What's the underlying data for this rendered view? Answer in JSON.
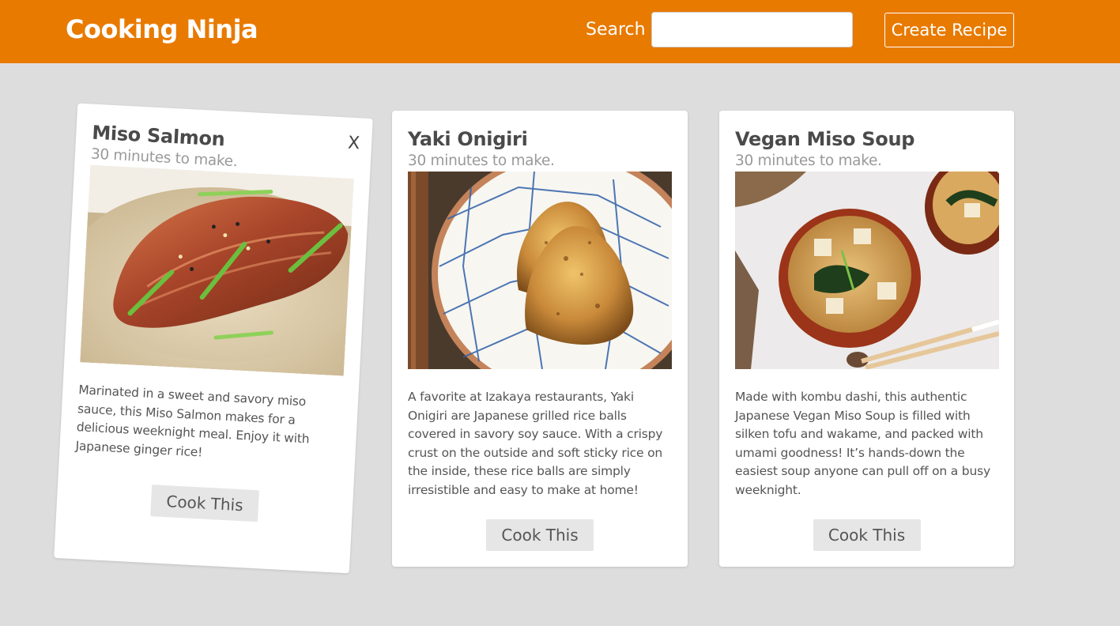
{
  "header": {
    "brand": "Cooking Ninja",
    "search_label": "Search",
    "search_value": "",
    "create_label": "Create Recipe",
    "accent_color": "#e87a00"
  },
  "recipes": [
    {
      "title": "Miso Salmon",
      "time": "30 minutes to make.",
      "image": "miso-salmon-photo",
      "description": "Marinated in a sweet and savory miso sauce, this Miso Salmon makes for a delicious weeknight meal. Enjoy it with Japanese ginger rice!",
      "button": "Cook This",
      "close": "X"
    },
    {
      "title": "Yaki Onigiri",
      "time": "30 minutes to make.",
      "image": "yaki-onigiri-photo",
      "description": "A favorite at Izakaya restaurants, Yaki Onigiri are Japanese grilled rice balls covered in savory soy sauce. With a crispy crust on the outside and soft sticky rice on the inside, these rice balls are simply irresistible and easy to make at home!",
      "button": "Cook This"
    },
    {
      "title": "Vegan Miso Soup",
      "time": "30 minutes to make.",
      "image": "vegan-miso-soup-photo",
      "description": "Made with kombu dashi, this authentic Japanese Vegan Miso Soup is filled with silken tofu and wakame, and packed with umami goodness! It’s hands-down the easiest soup anyone can pull off on a busy weeknight.",
      "button": "Cook This"
    }
  ]
}
